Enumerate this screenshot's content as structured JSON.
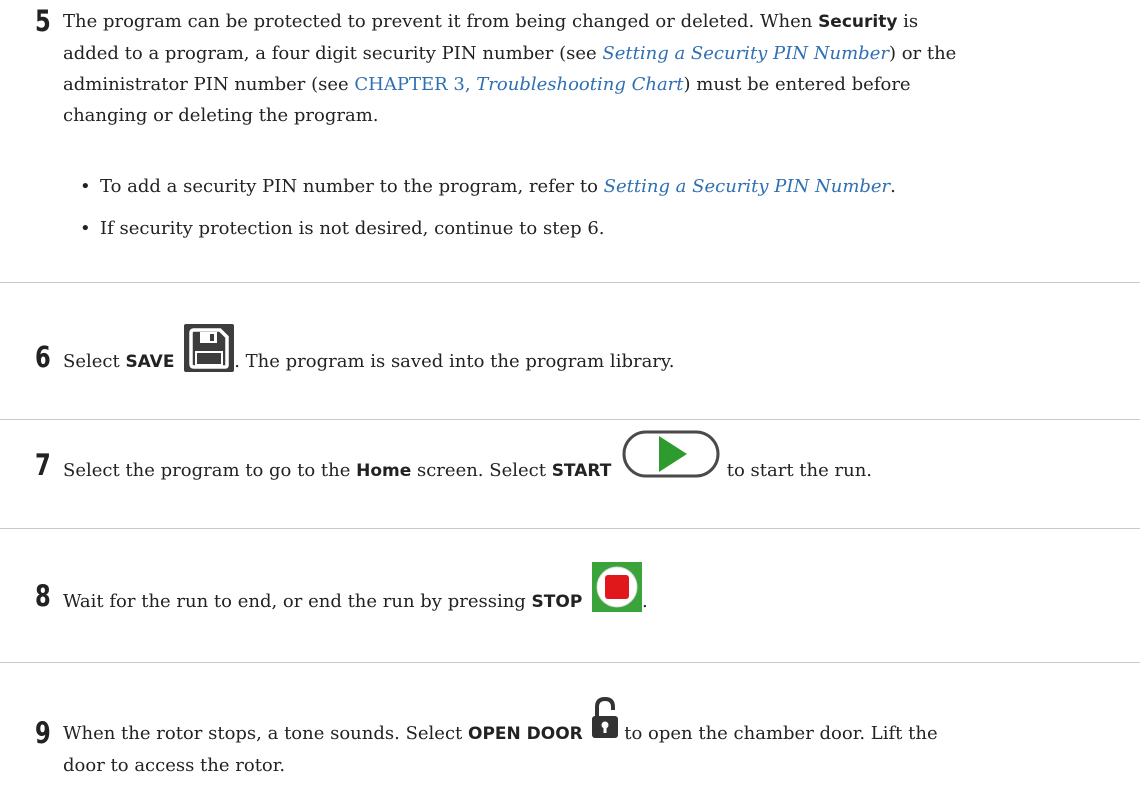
{
  "step5": {
    "number": "5",
    "line1_pre": "The program can be protected to prevent it from being changed or deleted. When ",
    "line1_bold": "Security",
    "line1_post": " is",
    "line2_pre": "added to a program, a four digit security PIN number (see ",
    "line2_link": "Setting a Security PIN Number",
    "line2_post": ") or the",
    "line3_pre": "administrator PIN number (see ",
    "line3_link_plain": "CHAPTER 3, ",
    "line3_link_italic": "Troubleshooting Chart",
    "line3_post": ") must be entered before",
    "line4": "changing or deleting the program.",
    "bullet1_pre": "To add a security PIN number to the program, refer to ",
    "bullet1_link": "Setting a Security PIN Number",
    "bullet1_post": ".",
    "bullet2": "If security protection is not desired, continue to step 6.",
    "bullet_char": "•"
  },
  "step6": {
    "number": "6",
    "pre": "Select ",
    "bold": "SAVE",
    "post": ". The program is saved into the program library.",
    "icon": "save-icon"
  },
  "step7": {
    "number": "7",
    "pre": "Select the program to go to the ",
    "bold1": "Home",
    "mid": " screen. Select ",
    "bold2": "START",
    "post": " to start the run.",
    "icon": "play-icon"
  },
  "step8": {
    "number": "8",
    "pre": "Wait for the run to end, or end the run by pressing ",
    "bold": "STOP",
    "post": ".",
    "icon": "stop-icon"
  },
  "step9": {
    "number": "9",
    "pre": "When the rotor stops, a tone sounds. Select ",
    "bold": "OPEN DOOR",
    "post": " to open the chamber door. Lift the",
    "line2": "door to access the rotor.",
    "icon": "unlock-icon"
  },
  "colors": {
    "link": "#2f6fb3",
    "divider": "#c8c8c8",
    "save_icon": "#3d3d3d",
    "play_green": "#2e9b2e",
    "stop_green": "#3aa33a",
    "stop_red": "#e0171b"
  }
}
